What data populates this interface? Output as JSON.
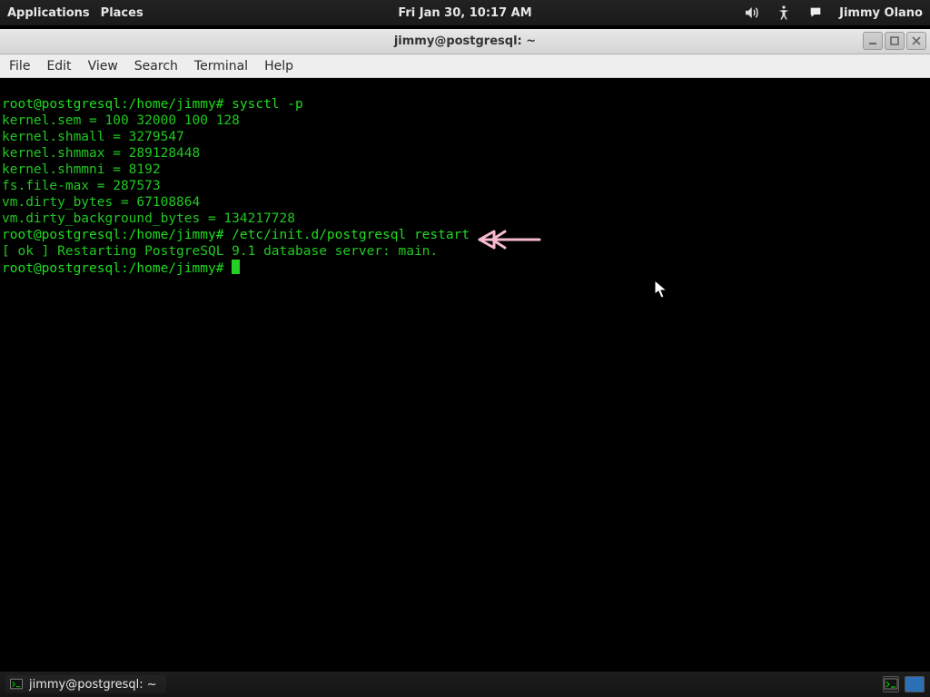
{
  "top_panel": {
    "applications": "Applications",
    "places": "Places",
    "clock": "Fri Jan 30, 10:17 AM",
    "user_name": "Jimmy Olano"
  },
  "window": {
    "title": "jimmy@postgresql: ~"
  },
  "menubar": {
    "file": "File",
    "edit": "Edit",
    "view": "View",
    "search": "Search",
    "terminal": "Terminal",
    "help": "Help"
  },
  "terminal_lines": [
    "root@postgresql:/home/jimmy# sysctl -p",
    "kernel.sem = 100 32000 100 128",
    "kernel.shmall = 3279547",
    "kernel.shmmax = 289128448",
    "kernel.shmmni = 8192",
    "fs.file-max = 287573",
    "vm.dirty_bytes = 67108864",
    "vm.dirty_background_bytes = 134217728",
    "root@postgresql:/home/jimmy# /etc/init.d/postgresql restart",
    "[ ok ] Restarting PostgreSQL 9.1 database server: main.",
    "root@postgresql:/home/jimmy# "
  ],
  "bottom_panel": {
    "task_label": "jimmy@postgresql: ~"
  }
}
